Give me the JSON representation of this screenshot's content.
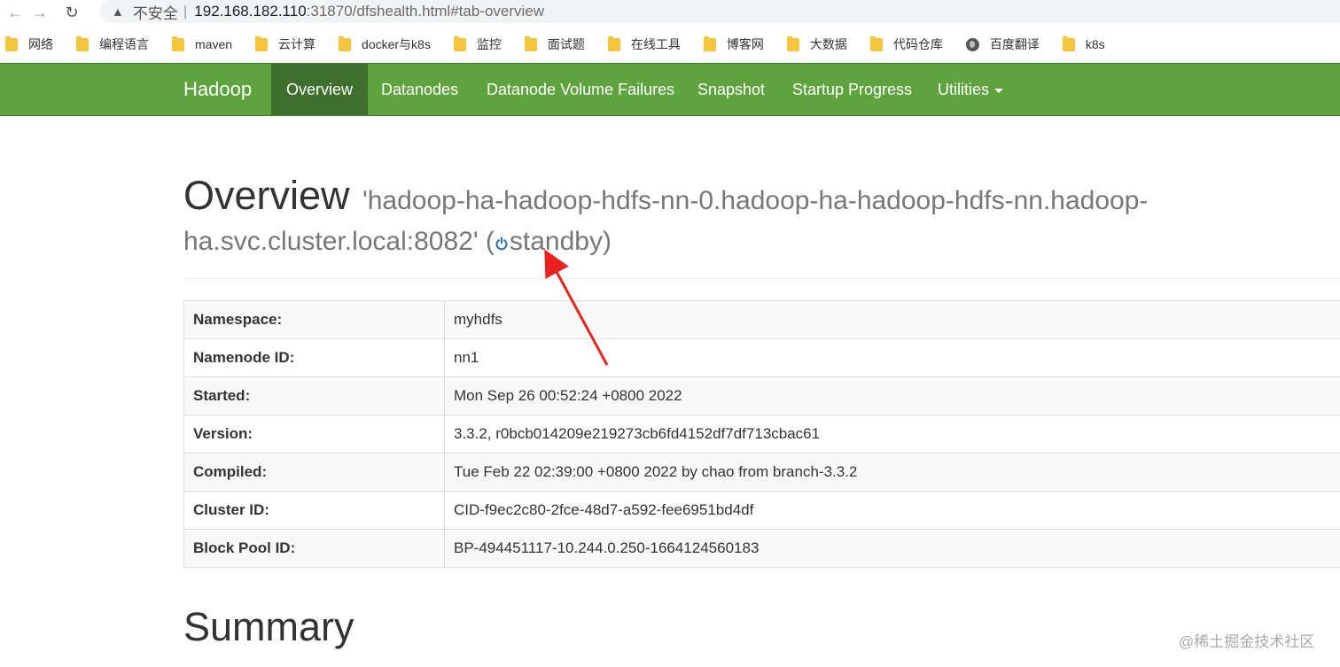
{
  "browser": {
    "insecure_label": "不安全",
    "url_host": "192.168.182.110",
    "url_rest": ":31870/dfshealth.html#tab-overview"
  },
  "bookmarks": [
    {
      "label": "网络",
      "icon": "folder-icon"
    },
    {
      "label": "编程语言",
      "icon": "folder-icon"
    },
    {
      "label": "maven",
      "icon": "folder-icon"
    },
    {
      "label": "云计算",
      "icon": "folder-icon"
    },
    {
      "label": "docker与k8s",
      "icon": "folder-icon"
    },
    {
      "label": "监控",
      "icon": "folder-icon"
    },
    {
      "label": "面试题",
      "icon": "folder-icon"
    },
    {
      "label": "在线工具",
      "icon": "folder-icon"
    },
    {
      "label": "博客网",
      "icon": "folder-icon"
    },
    {
      "label": "大数据",
      "icon": "folder-icon"
    },
    {
      "label": "代码仓库",
      "icon": "folder-icon"
    },
    {
      "label": "百度翻译",
      "icon": "globe-icon"
    },
    {
      "label": "k8s",
      "icon": "folder-icon"
    }
  ],
  "navbar": {
    "brand": "Hadoop",
    "items": [
      "Overview",
      "Datanodes",
      "Datanode Volume Failures",
      "Snapshot",
      "Startup Progress",
      "Utilities"
    ],
    "active_index": 0,
    "color": "#5fa33e"
  },
  "overview": {
    "title": "Overview",
    "host_line1": "'hadoop-ha-hadoop-hdfs-nn-0.hadoop-ha-hadoop-hdfs-nn.hadoop-",
    "host_line2": "ha.svc.cluster.local:8082' (",
    "state": "standby",
    "state_close": ")"
  },
  "info_rows": [
    {
      "key": "Namespace:",
      "value": "myhdfs"
    },
    {
      "key": "Namenode ID:",
      "value": "nn1"
    },
    {
      "key": "Started:",
      "value": "Mon Sep 26 00:52:24 +0800 2022"
    },
    {
      "key": "Version:",
      "value": "3.3.2, r0bcb014209e219273cb6fd4152df7df713cbac61"
    },
    {
      "key": "Compiled:",
      "value": "Tue Feb 22 02:39:00 +0800 2022 by chao from branch-3.3.2"
    },
    {
      "key": "Cluster ID:",
      "value": "CID-f9ec2c80-2fce-48d7-a592-fee6951bd4df"
    },
    {
      "key": "Block Pool ID:",
      "value": "BP-494451117-10.244.0.250-1664124560183"
    }
  ],
  "summary_title": "Summary",
  "watermark": "@稀土掘金技术社区",
  "annotation_color": "#e8231f"
}
